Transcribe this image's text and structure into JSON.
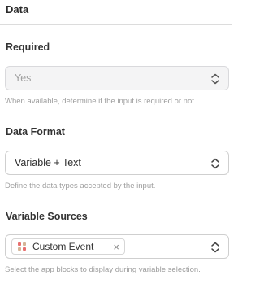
{
  "section": {
    "title": "Data"
  },
  "fields": {
    "required": {
      "label": "Required",
      "value": "Yes",
      "help": "When available, determine if the input is required or not."
    },
    "data_format": {
      "label": "Data Format",
      "value": "Variable + Text",
      "help": "Define the data types accepted by the input."
    },
    "variable_sources": {
      "label": "Variable Sources",
      "chip_label": "Custom Event",
      "chip_remove": "×",
      "help": "Select the app blocks to display during variable selection."
    }
  },
  "icons": {
    "select_arrow": "chevron-up-down-icon",
    "chip_icon": "custom-event-icon",
    "chip_remove": "close-icon"
  },
  "colors": {
    "chip_icon_red": "#e86f6f",
    "chip_icon_tan": "#d4b496"
  }
}
